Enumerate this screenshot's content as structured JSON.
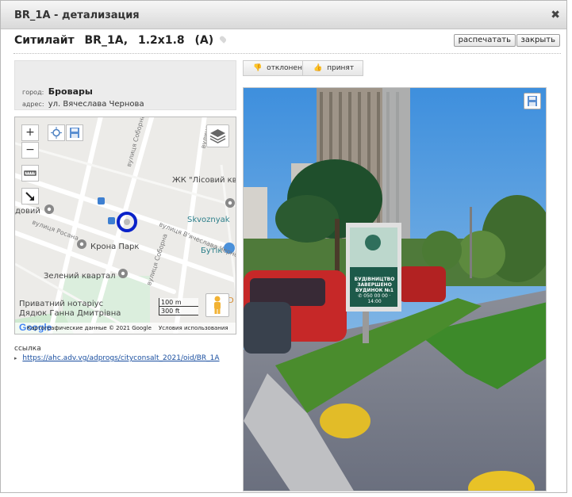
{
  "dialog": {
    "title": "BR_1A - детализация",
    "close_icon": "✖"
  },
  "header": {
    "brand": "Ситилайт",
    "code": "BR_1A,",
    "size": "1.2x1.8",
    "side": "(A)",
    "print_label": "распечатать",
    "close_label": "закрыть"
  },
  "address": {
    "city_label": "город:",
    "city": "Бровары",
    "street_label": "адрес:",
    "street": "ул. Вячеслава Чернова"
  },
  "map": {
    "zoom_in": "+",
    "zoom_out": "−",
    "labels": {
      "lisovy": "ЖК \"Лісовий кв",
      "skvoznyak": "Skvoznyak",
      "krona": "Крона Парк",
      "zeleny": "Зелений квартал",
      "notary1": "Приватний нотаріус",
      "notary2": "Дядюк Ганна Дмитрівна",
      "butik": "Бутік",
      "dovy": "довий",
      "d": "D"
    },
    "streets": {
      "sobornaya1": "вулиця Соборна",
      "sobornaya2": "вулиця Соборна",
      "chernova": "вулиця В'ячеслава Черно",
      "rosana": "вулиця Росана",
      "vulytsia": "вулиця"
    },
    "scale_m": "100 m",
    "scale_ft": "300 ft",
    "attribution": "Картографические данные © 2021 Google",
    "terms": "Условия использования",
    "google": "Google"
  },
  "link": {
    "label": "ссылка",
    "url": "https://ahc.adv.vg/adprogs/cityconsalt_2021/oid/BR_1A"
  },
  "status": {
    "rejected": "отклонен",
    "accepted": "принят"
  },
  "photo": {
    "billboard_line1": "БУДІВНИЦТВО",
    "billboard_line2": "ЗАВЕРШЕНО",
    "billboard_line3": "БУДИНОК №1",
    "billboard_phone": "✆ 050 00 00 · 14:00"
  }
}
